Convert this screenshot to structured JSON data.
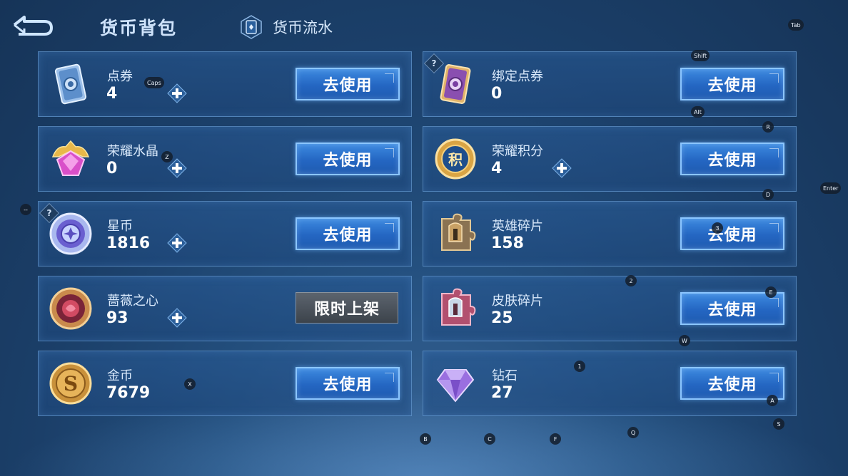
{
  "header": {
    "title": "货币背包",
    "flow_tab_label": "货币流水"
  },
  "currencies": [
    {
      "name": "点券",
      "amount": "4",
      "action": "去使用",
      "icon": "coupon-card-icon"
    },
    {
      "name": "绑定点券",
      "amount": "0",
      "action": "去使用",
      "icon": "bound-coupon-card-icon"
    },
    {
      "name": "荣耀水晶",
      "amount": "0",
      "action": "去使用",
      "icon": "glory-crystal-icon"
    },
    {
      "name": "荣耀积分",
      "amount": "4",
      "action": "去使用",
      "icon": "glory-points-icon",
      "icon_glyph": "积"
    },
    {
      "name": "星币",
      "amount": "1816",
      "action": "去使用",
      "icon": "star-coin-icon"
    },
    {
      "name": "英雄碎片",
      "amount": "158",
      "action": "去使用",
      "icon": "hero-fragment-icon"
    },
    {
      "name": "蔷薇之心",
      "amount": "93",
      "action": "限时上架",
      "icon": "rose-heart-icon"
    },
    {
      "name": "皮肤碎片",
      "amount": "25",
      "action": "去使用",
      "icon": "skin-fragment-icon"
    },
    {
      "name": "金币",
      "amount": "7679",
      "action": "去使用",
      "icon": "gold-coin-icon",
      "icon_glyph": "S"
    },
    {
      "name": "钻石",
      "amount": "27",
      "action": "去使用",
      "icon": "diamond-icon"
    }
  ],
  "help_mark": "?",
  "key_hints": {
    "tab": "Tab",
    "shift": "Shift",
    "alt": "Alt",
    "caps": "Caps",
    "r": "R",
    "z": "Z",
    "enter": "Enter",
    "d": "D",
    "dash": "--",
    "three": "3",
    "two": "2",
    "e": "E",
    "w": "W",
    "one": "1",
    "x": "X",
    "a": "A",
    "s": "S",
    "b": "B",
    "c": "C",
    "f": "F",
    "q": "Q"
  },
  "colors": {
    "background": "#1b3f69",
    "button_blue": "#2466c2",
    "button_border": "#8cc6ff",
    "limited_gray": "#4a525b"
  }
}
